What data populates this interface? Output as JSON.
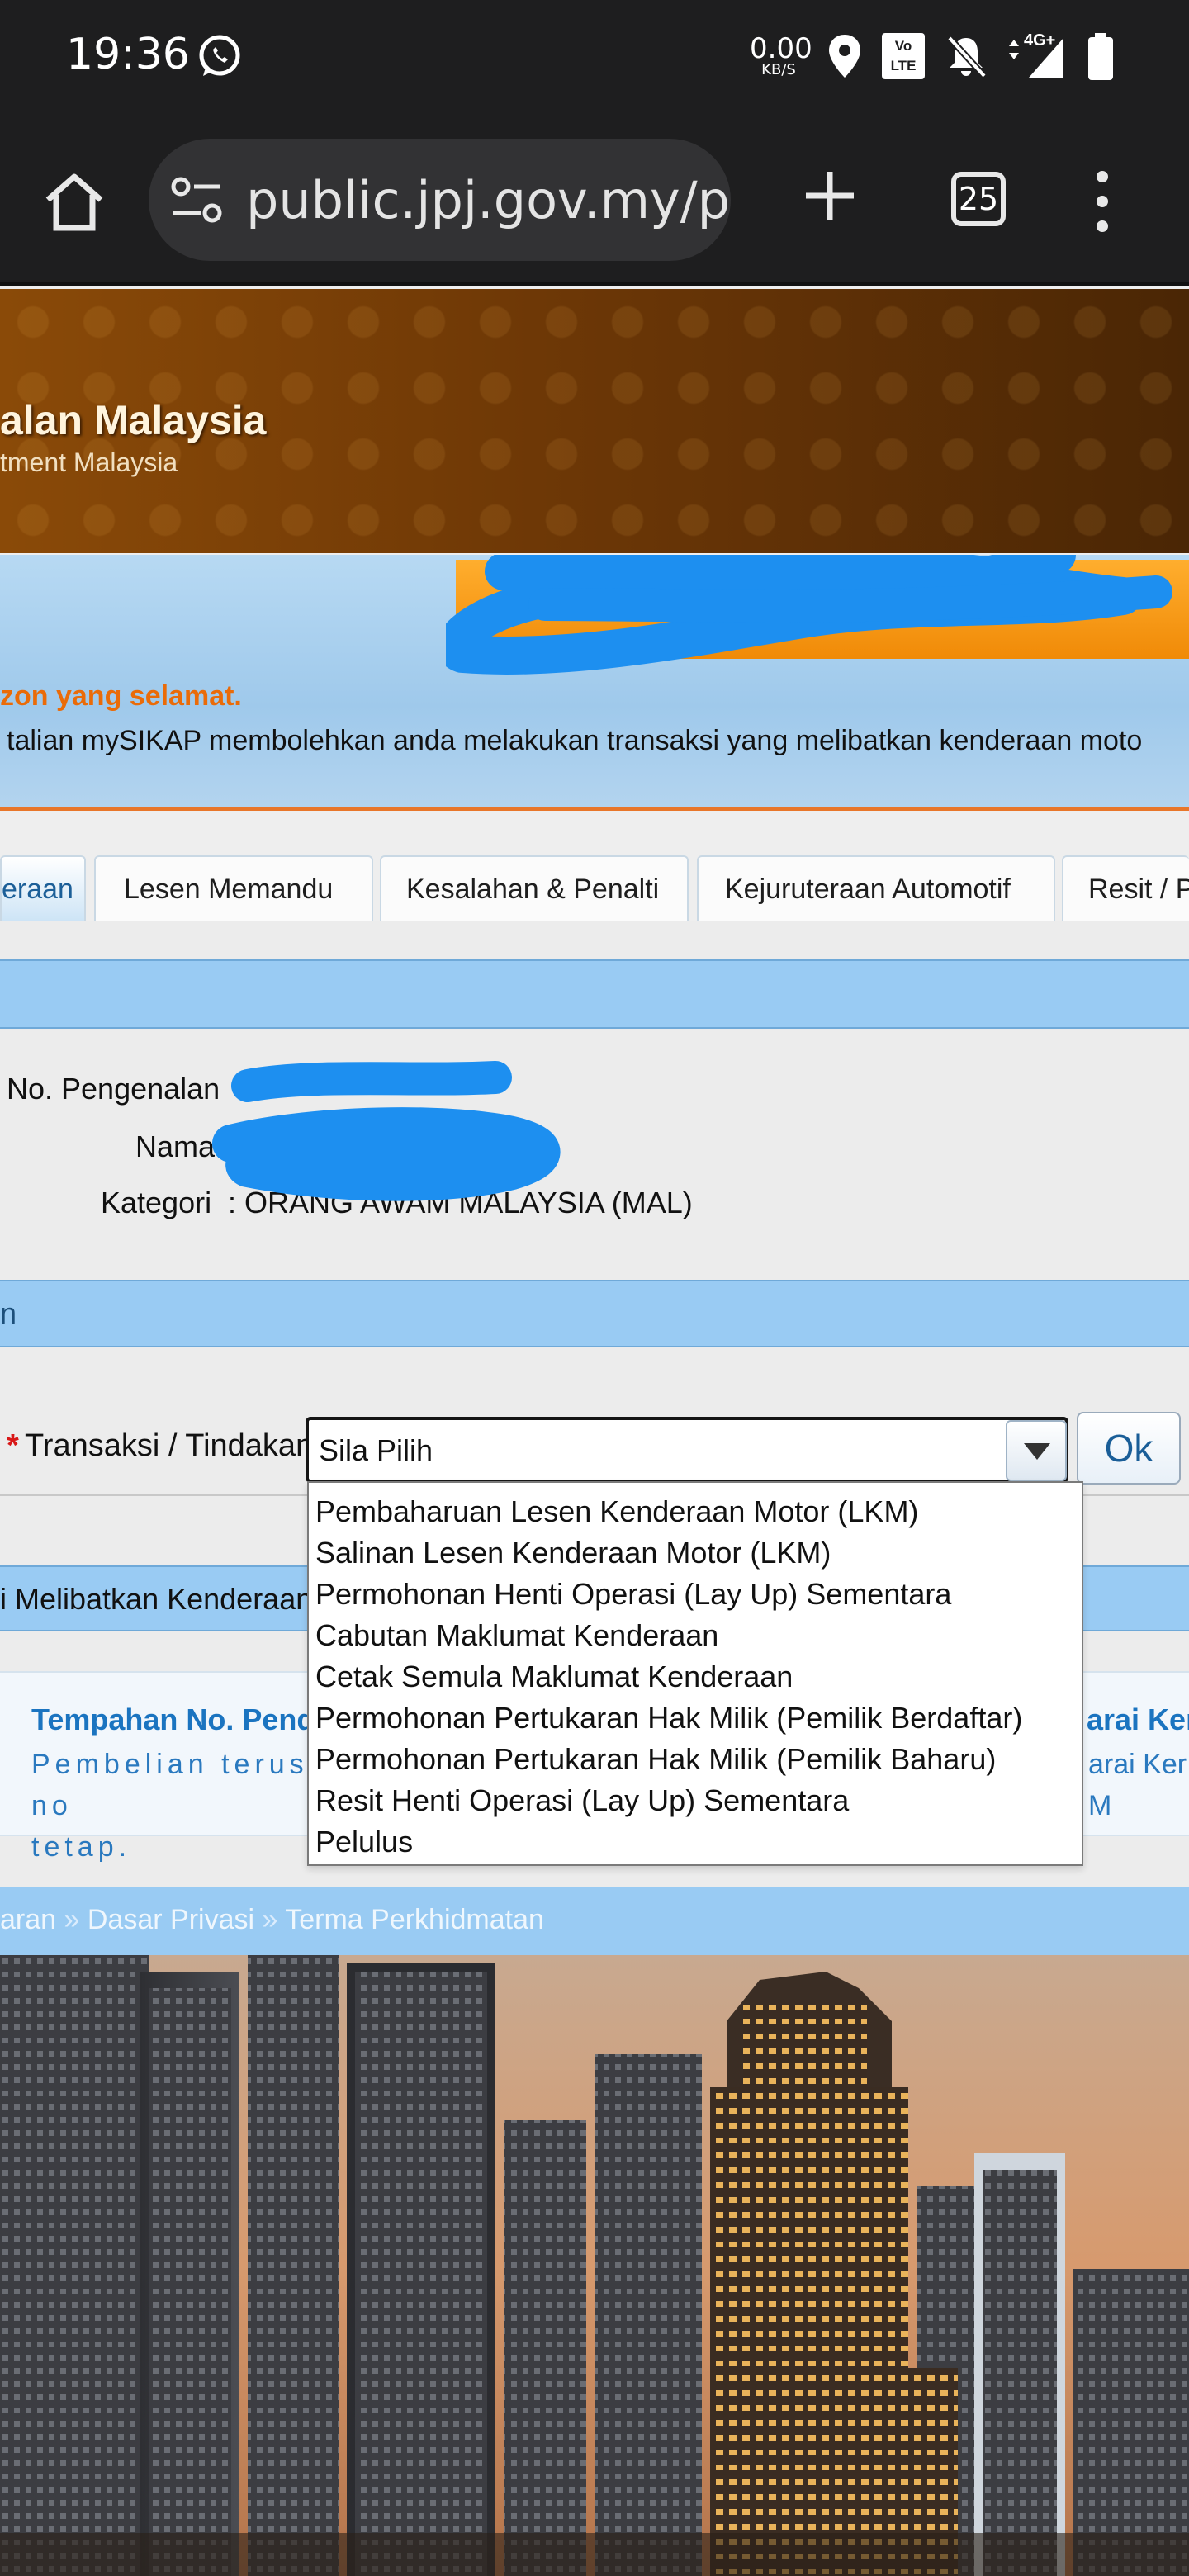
{
  "status_bar": {
    "time": "19:36",
    "net_speed_value": "0.00",
    "net_speed_unit": "KB/S",
    "volte_line1": "Vo",
    "volte_line2": "LTE",
    "network_type": "4G+"
  },
  "browser": {
    "url": "public.jpj.gov.my/publ",
    "tab_count": "25"
  },
  "header": {
    "title": "alan Malaysia",
    "subtitle": "tment Malaysia"
  },
  "welcome": {
    "heading": "zon yang selamat.",
    "text": " talian mySIKAP membolehkan anda melakukan transaksi yang melibatkan kenderaan moto"
  },
  "tabs": [
    {
      "label": "eraan"
    },
    {
      "label": "Lesen Memandu"
    },
    {
      "label": "Kesalahan & Penalti"
    },
    {
      "label": "Kejuruteraan Automotif"
    },
    {
      "label": "Resit / P"
    }
  ],
  "user_info": {
    "id_label": "No. Pengenalan",
    "name_label": "Nama",
    "category_label": "Kategori",
    "category_value": ": ORANG AWAM MALAYSIA (MAL)"
  },
  "section_bar_2": "n",
  "transaction": {
    "label": "Transaksi / Tindakan",
    "selected": "Sila Pilih",
    "ok_label": "Ok",
    "options": [
      "Pembaharuan Lesen Kenderaan Motor (LKM)",
      "Salinan Lesen Kenderaan Motor (LKM)",
      "Permohonan Henti Operasi (Lay Up) Sementara",
      "Cabutan Maklumat Kenderaan",
      "Cetak Semula Maklumat Kenderaan",
      "Permohonan Pertukaran Hak Milik (Pemilik Berdaftar)",
      "Permohonan Pertukaran Hak Milik (Pemilik Baharu)",
      "Resit Henti Operasi (Lay Up) Sementara",
      "Pelulus"
    ]
  },
  "section_bar_3": "i Melibatkan Kenderaan",
  "card": {
    "title_left": "Tempahan No. Penda",
    "text_left_line1": "Pembelian terus no",
    "text_left_line2": "tetap.",
    "title_right": "arai Kenc",
    "text_right_line1": "arai Ker",
    "text_right_line2": "M"
  },
  "footer": {
    "link1": "aran",
    "link2": "Dasar Privasi",
    "link3": "Terma Perkhidmatan",
    "separator": " » "
  },
  "colors": {
    "accent_blue": "#99cbf3",
    "header_brown": "#6e3806",
    "orange": "#f08a07",
    "redaction": "#1d8ff0"
  }
}
